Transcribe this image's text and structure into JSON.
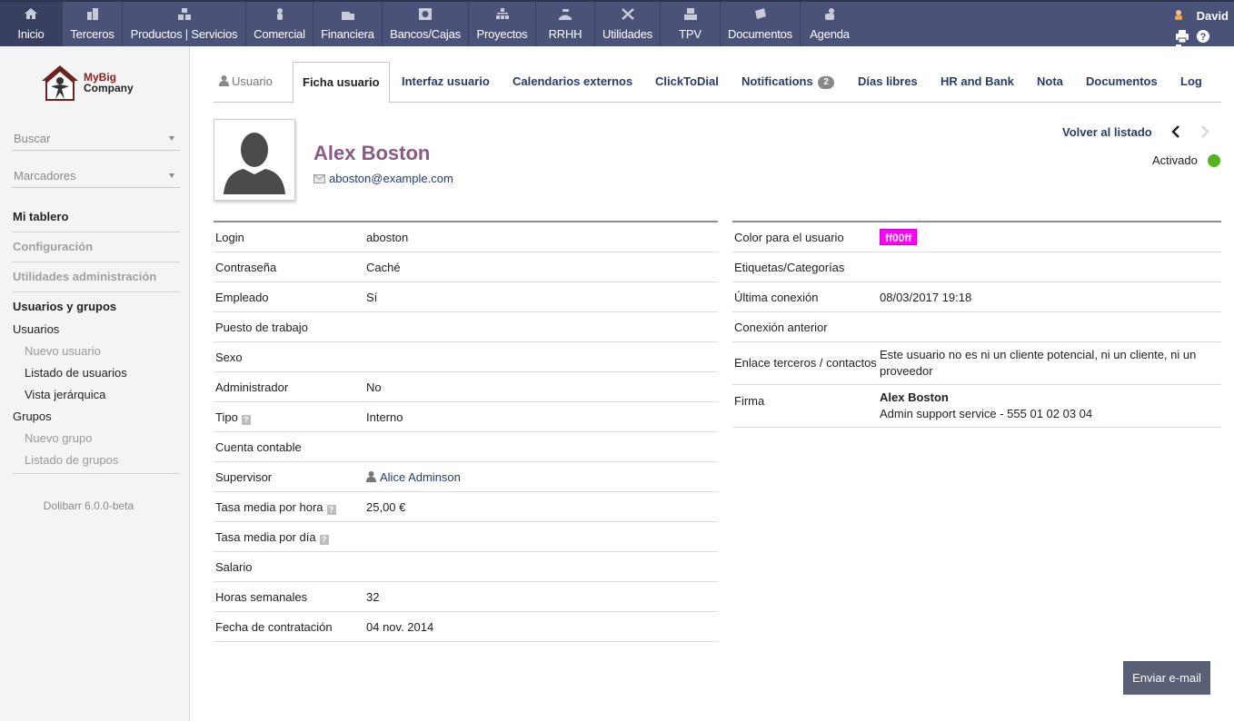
{
  "topmenu": [
    {
      "label": "Inicio",
      "icon": "home-icon"
    },
    {
      "label": "Terceros",
      "icon": "building-icon"
    },
    {
      "label": "Productos | Servicios",
      "icon": "boxes-icon"
    },
    {
      "label": "Comercial",
      "icon": "commercial-icon"
    },
    {
      "label": "Financiera",
      "icon": "finance-icon"
    },
    {
      "label": "Bancos/Cajas",
      "icon": "bank-icon"
    },
    {
      "label": "Proyectos",
      "icon": "projects-icon"
    },
    {
      "label": "RRHH",
      "icon": "hr-icon"
    },
    {
      "label": "Utilidades",
      "icon": "tools-icon"
    },
    {
      "label": "TPV",
      "icon": "pos-icon"
    },
    {
      "label": "Documentos",
      "icon": "documents-icon"
    },
    {
      "label": "Agenda",
      "icon": "agenda-icon"
    }
  ],
  "user": {
    "name": "David"
  },
  "sidebar": {
    "logo_line1": "MyBig",
    "logo_line2": "Company",
    "search_placeholder": "Buscar",
    "bookmarks_placeholder": "Marcadores",
    "dashboard": "Mi tablero",
    "config": "Configuración",
    "admin_tools": "Utilidades administración",
    "users_groups": "Usuarios y grupos",
    "users": "Usuarios",
    "new_user": "Nuevo usuario",
    "list_users": "Listado de usuarios",
    "hierarchy": "Vista jerárquica",
    "groups": "Grupos",
    "new_group": "Nuevo grupo",
    "list_groups": "Listado de grupos",
    "version": "Dolibarr 6.0.0-beta"
  },
  "tabs": {
    "user": "Usuario",
    "card": "Ficha usuario",
    "interface": "Interfaz usuario",
    "calendars": "Calendarios externos",
    "clicktodial": "ClickToDial",
    "notifications": "Notifications",
    "notifications_count": "2",
    "days_off": "Días libres",
    "hr_bank": "HR and Bank",
    "note": "Nota",
    "documents": "Documentos",
    "log": "Log"
  },
  "profile": {
    "full_name": "Alex Boston",
    "email": "aboston@example.com",
    "back_label": "Volver al listado",
    "status": "Activado",
    "status_color": "#53b51e"
  },
  "left_fields": [
    {
      "label": "Login",
      "value": "aboston"
    },
    {
      "label": "Contraseña",
      "value": "Caché"
    },
    {
      "label": "Empleado",
      "value": "Sí"
    },
    {
      "label": "Puesto de trabajo",
      "value": ""
    },
    {
      "label": "Sexo",
      "value": ""
    },
    {
      "label": "Administrador",
      "value": "No"
    },
    {
      "label": "Tipo",
      "value": "Interno"
    },
    {
      "label": "Cuenta contable",
      "value": ""
    },
    {
      "label": "Supervisor",
      "value": "Alice Adminson"
    },
    {
      "label": "Tasa media por hora",
      "value": "25,00 €"
    },
    {
      "label": "Tasa media por día",
      "value": ""
    },
    {
      "label": "Salario",
      "value": ""
    },
    {
      "label": "Horas semanales",
      "value": "32"
    },
    {
      "label": "Fecha de contratación",
      "value": "04 nov. 2014"
    }
  ],
  "right_fields": {
    "color_label": "Color para el usuario",
    "color_value": "ff00ff",
    "tags_label": "Etiquetas/Categorías",
    "last_login_label": "Última conexión",
    "last_login_value": "08/03/2017 19:18",
    "prev_login_label": "Conexión anterior",
    "link_label": "Enlace terceros / contactos",
    "link_value": "Este usuario no es ni un cliente potencial, ni un cliente, ni un proveedor",
    "signature_label": "Firma",
    "signature_name": "Alex Boston",
    "signature_line": "Admin support service - 555 01 02 03 04"
  },
  "actions": {
    "send_email": "Enviar e-mail"
  },
  "help_glyph": "?"
}
